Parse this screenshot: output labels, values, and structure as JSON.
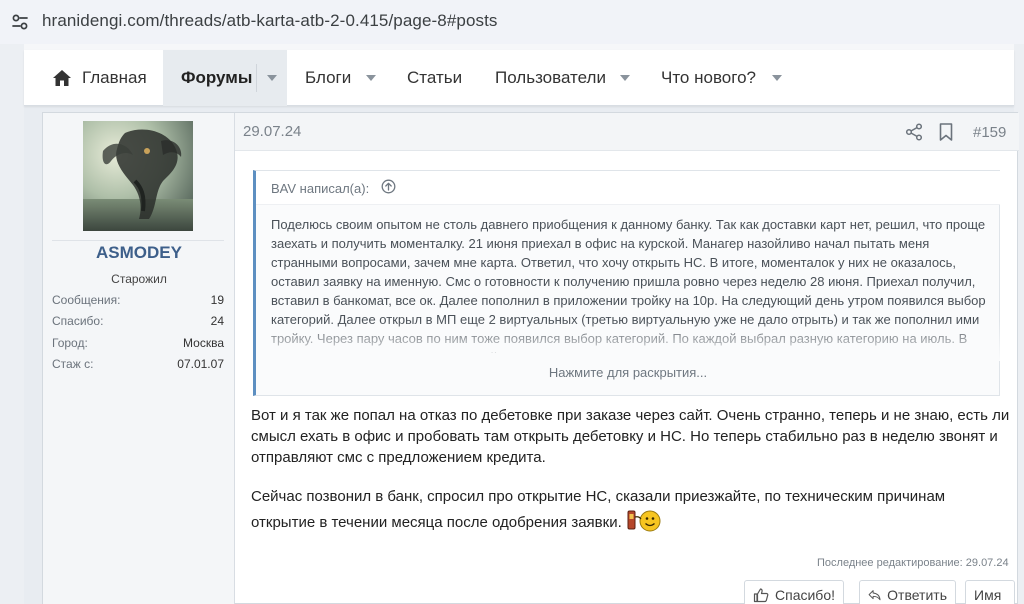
{
  "browser": {
    "url": "hranidengi.com/threads/atb-karta-atb-2-0.415/page-8#posts"
  },
  "nav": {
    "home": "Главная",
    "forums": "Форумы",
    "blogs": "Блоги",
    "articles": "Статьи",
    "users": "Пользователи",
    "whats_new": "Что нового?"
  },
  "user": {
    "name": "ASMODEY",
    "title": "Старожил",
    "stats": [
      {
        "label": "Сообщения:",
        "value": "19"
      },
      {
        "label": "Спасибо:",
        "value": "24"
      },
      {
        "label": "Город:",
        "value": "Москва"
      },
      {
        "label": "Стаж с:",
        "value": "07.01.07"
      }
    ]
  },
  "post": {
    "date": "29.07.24",
    "number": "#159",
    "quote": {
      "author_line": "BAV написал(а):",
      "text": "Поделюсь своим опытом не столь давнего приобщения к данному банку. Так как доставки карт нет, решил, что проще заехать и получить моменталку. 21 июня приехал в офис на курской. Манагер назойливо начал пытать меня странными вопросами, зачем мне карта. Ответил, что хочу открыть НС. В итоге, моменталок у них не оказалось, оставил заявку на именную. Смс о готовности к получению пришла ровно через неделю 28 июня. Приехал получил, вставил в банкомат, все ок. Далее пополнил в приложении тройку на 10р. На следующий день утром появился выбор категорий. Далее открыл в МП еще 2 виртуальных (третью виртуальную уже не дало отрыть) и так же пополнил ими тройку. Через пару часов по ним тоже появился выбор категорий. По каждой выбрал разную категорию на июль. В июле пользовался пока только одной",
      "expand": "Нажмите для раскрытия..."
    },
    "paragraph1": "Вот и я так же попал на отказ по дебетовке при заказе через сайт. Очень странно, теперь и не знаю, есть ли смысл ехать в офис и пробовать там открыть дебетовку и НС. Но теперь стабильно раз в неделю звонят и отправляют смс с предложением кредита.",
    "paragraph2": "Сейчас позвонил в банк, спросил про открытие НС, сказали приезжайте, по техническим причинам открытие в течении месяца после одобрения заявки.",
    "edited": "Последнее редактирование: 29.07.24",
    "buttons": {
      "thanks": "Спасибо!",
      "reply": "Ответить",
      "name": "Имя"
    }
  }
}
